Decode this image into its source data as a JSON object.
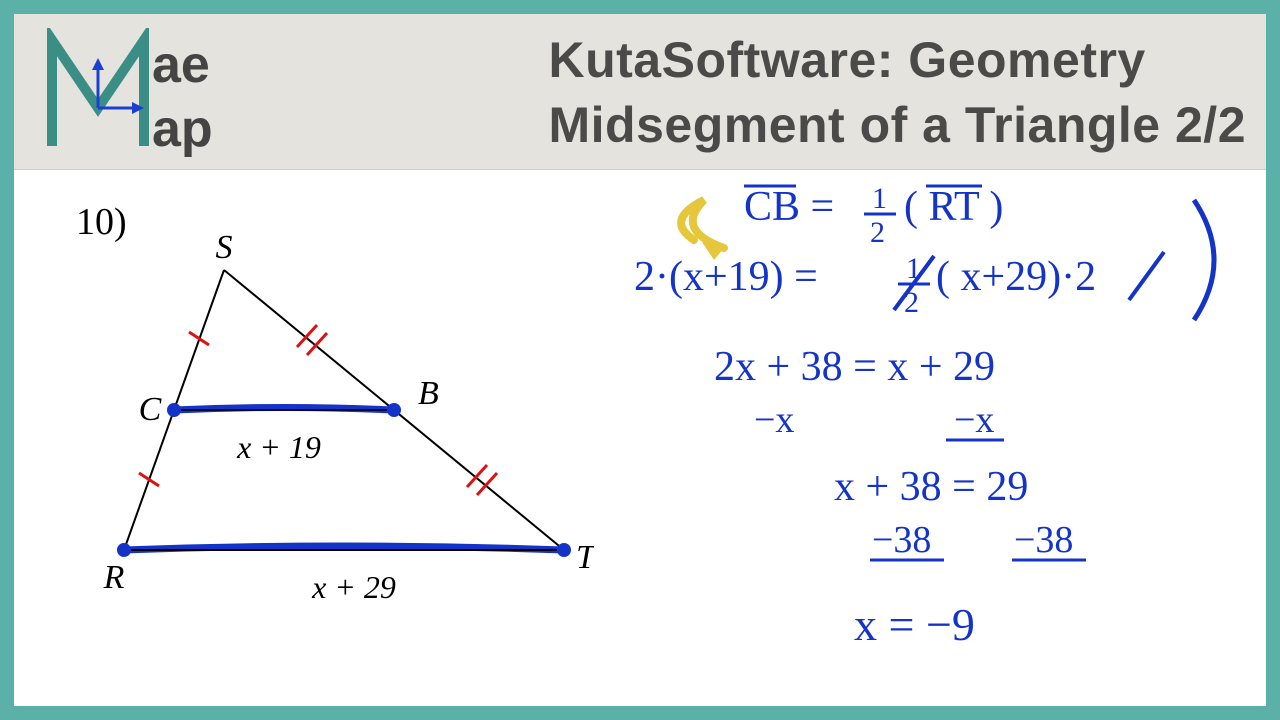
{
  "header": {
    "brand": {
      "word1": "ae",
      "word2": "ap"
    },
    "title_line1": "KutaSoftware: Geometry",
    "title_line2": "Midsegment of a Triangle 2/2"
  },
  "problem": {
    "number": "10)",
    "vertices": {
      "S": "S",
      "R": "R",
      "T": "T",
      "C": "C",
      "B": "B"
    },
    "midsegment_expr": "x + 19",
    "base_expr": "x + 29"
  },
  "work": {
    "line1": "CB = ½ (RT)",
    "line2": "2·(x+19) = ½ (x+29)·2",
    "line3": "2x + 38 = x + 29",
    "line4a": "−x",
    "line4b": "−x",
    "line5": "x + 38 = 29",
    "line6a": "−38",
    "line6b": "−38",
    "line7": "x = −9"
  }
}
